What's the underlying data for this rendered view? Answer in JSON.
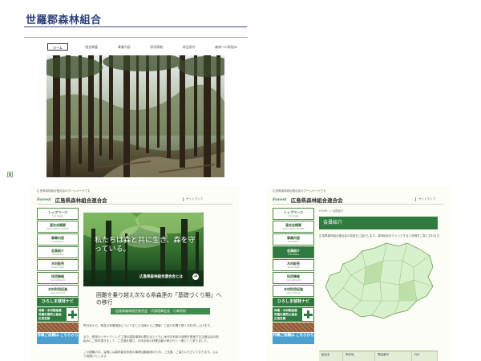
{
  "top_site": {
    "title": "世羅郡森林組合",
    "nav": [
      {
        "label": "ホーム",
        "active": true
      },
      {
        "label": "組合概要",
        "active": false
      },
      {
        "label": "事業内容",
        "active": false
      },
      {
        "label": "採用情報",
        "active": false
      },
      {
        "label": "商品案内",
        "active": false
      },
      {
        "label": "森林への取組み",
        "active": false
      }
    ]
  },
  "left_site": {
    "tagline": "広島県森林組合連合会のホームページです。",
    "logo": "Forest",
    "site_name": "広島県森林組合連合会",
    "sitemap": "サイトマップ",
    "sidebar": [
      {
        "jp": "トップページ",
        "en": "top page"
      },
      {
        "jp": "連合会概要",
        "en": "association profile"
      },
      {
        "jp": "事業内容",
        "en": "business"
      },
      {
        "jp": "会員紹介",
        "en": "members"
      },
      {
        "jp": "木材販売",
        "en": "wood sale"
      },
      {
        "jp": "採用情報",
        "en": "recruitment"
      },
      {
        "jp": "木材利用促進",
        "en": "use of wood"
      }
    ],
    "banner_navi": "ひろしま就林ナビ",
    "banner_navi_text": "林業・木材製造業労働災害防止協会 広島支部",
    "banner_blue": "作業ご依頼は こちらから",
    "hero_slogan": "私たちは森と共に生き、森を守っている。",
    "hero_caption": "広島県森林組合連合会とは",
    "hero_arrow": "➔",
    "heading": "困難を乗り越え次なる県森連の「基礎づくり期」への移行",
    "author": "広島県森林組合連合会　代表理事会長　小林秀則",
    "paragraphs": [
      "昨日あから、県会の林業施設についてました当時からご理解、ご協力を賜り厚くお礼申し上げます。",
      "また、県営のリサイクリング工場の建設事業の着手点とともに木材の利用の施策を推進する当連合会の取組みにご賛同頂きまして、ご支援を賜り。日本全体の林業活動の伸び行く一業として参りました。",
      "この困難の中、皆様には森林組合系統の事業活動継続のため、ご支援、ご協力いただいております。心より感謝いたします。"
    ]
  },
  "right_site": {
    "tagline": "広島県森林組合連合会のホームページです。",
    "logo": "Forest",
    "site_name": "広島県森林組合連合会",
    "sitemap": "サイトマップ",
    "sidebar": [
      {
        "jp": "トップページ",
        "en": "top page",
        "active": false
      },
      {
        "jp": "連合会概要",
        "en": "association profile",
        "active": false
      },
      {
        "jp": "事業内容",
        "en": "business",
        "active": false
      },
      {
        "jp": "会員紹介",
        "en": "members",
        "active": true
      },
      {
        "jp": "木材販売",
        "en": "wood sale",
        "active": false
      },
      {
        "jp": "採用情報",
        "en": "recruitment",
        "active": false
      },
      {
        "jp": "木材利用促進",
        "en": "use of wood",
        "active": false
      }
    ],
    "banner_navi": "ひろしま就林ナビ",
    "banner_navi_text": "林業・木材製造業労働災害防止協会 広島支部",
    "banner_blue": "作業ご依頼は こちらから",
    "breadcrumb": "HOME ＞ 会員紹介",
    "banner": "会員紹介",
    "description": "広島県森林組合連合会の会員をご紹介します。森林組合をクリックすると詳細をご覧になれます。",
    "table_headers": [
      "組合名",
      "所在地",
      "電話番号",
      "FAX"
    ]
  },
  "colors": {
    "forest_green": "#2f7a3e",
    "navy_title": "#2a3f7a"
  }
}
